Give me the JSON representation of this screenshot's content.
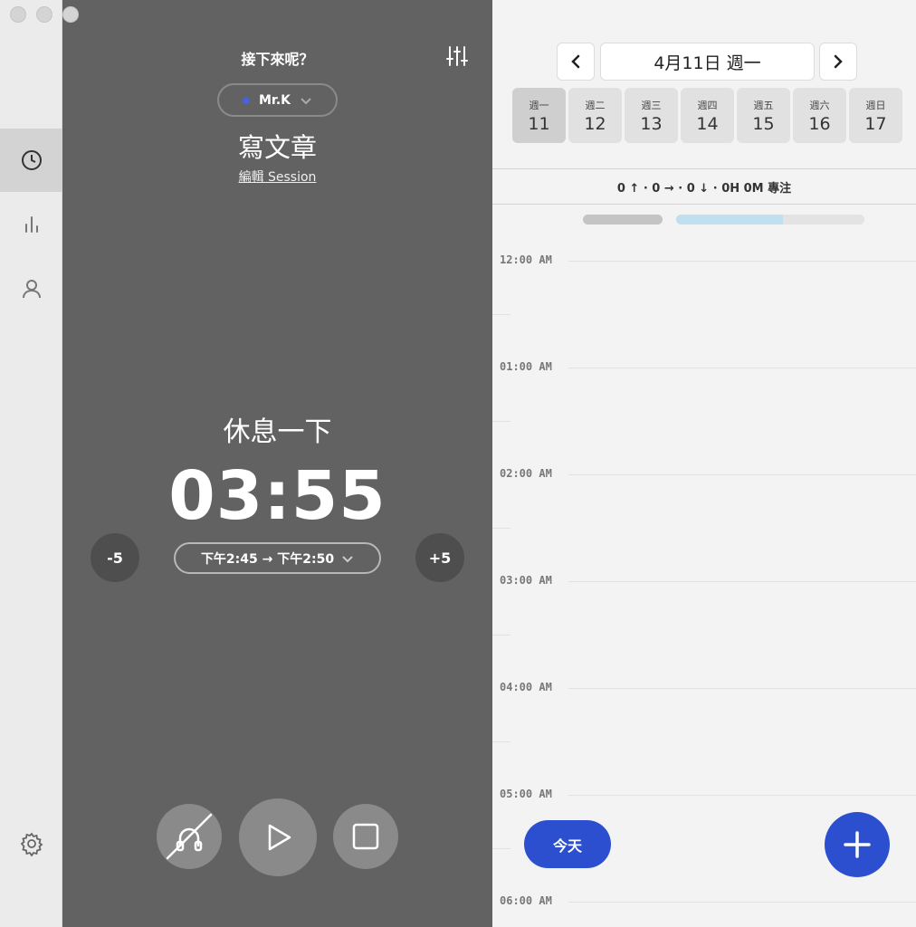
{
  "window": {
    "traffic_lights": [
      "close",
      "minimize",
      "zoom"
    ]
  },
  "sidebar": {
    "items": [
      {
        "icon": "clock-icon",
        "active": true
      },
      {
        "icon": "bar-chart-icon",
        "active": false
      },
      {
        "icon": "person-icon",
        "active": false
      }
    ],
    "footer_icon": "gear-icon"
  },
  "timer": {
    "header": "接下來呢？",
    "profile": {
      "name": "Mr.K",
      "dot_color": "#4a62d9"
    },
    "task_title": "寫文章",
    "edit_link": "編輯 Session",
    "mode": "休息一下",
    "time": "03:55",
    "minus_label": "-5",
    "plus_label": "+5",
    "range": "下午2:45 → 下午2:50",
    "controls": [
      "headphones-off-icon",
      "play-icon",
      "stop-icon"
    ]
  },
  "calendar": {
    "date_label": "4月11日 週一",
    "days": [
      {
        "weekday": "週一",
        "date": "11",
        "selected": true
      },
      {
        "weekday": "週二",
        "date": "12",
        "selected": false
      },
      {
        "weekday": "週三",
        "date": "13",
        "selected": false
      },
      {
        "weekday": "週四",
        "date": "14",
        "selected": false
      },
      {
        "weekday": "週五",
        "date": "15",
        "selected": false
      },
      {
        "weekday": "週六",
        "date": "16",
        "selected": false
      },
      {
        "weekday": "週日",
        "date": "17",
        "selected": false
      }
    ],
    "summary": "0 ↑ · 0 → · 0 ↓ · 0H 0M 專注",
    "hours": [
      "12:00 AM",
      "01:00 AM",
      "02:00 AM",
      "03:00 AM",
      "04:00 AM",
      "05:00 AM",
      "06:00 AM"
    ],
    "today_label": "今天",
    "accent_color": "#2b4fcf"
  }
}
